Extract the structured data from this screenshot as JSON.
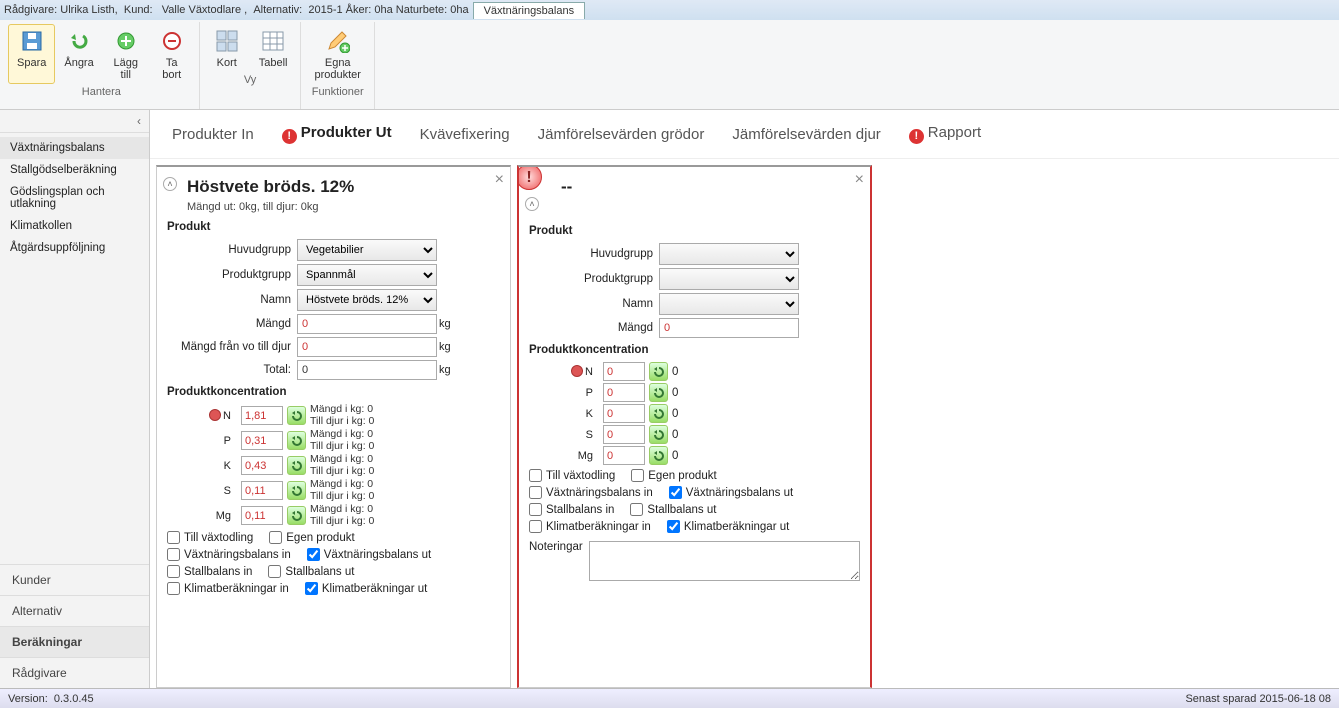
{
  "title": {
    "advisor_lbl": "Rådgivare:",
    "advisor_val": "Ulrika Listh,",
    "cust_lbl": "Kund:",
    "cust_val": "Valle Växtodlare ,",
    "alt_lbl": "Alternativ:",
    "alt_val": "2015-1 Åker: 0ha Naturbete: 0ha",
    "tab": "Växtnäringsbalans"
  },
  "ribbon": {
    "spara": "Spara",
    "angra": "Ångra",
    "lagg": "Lägg\ntill",
    "tabort": "Ta\nbort",
    "kort": "Kort",
    "tabell": "Tabell",
    "egna": "Egna\nprodukter",
    "g1": "Hantera",
    "g2": "Vy",
    "g3": "Funktioner"
  },
  "sidebar": {
    "items": [
      "Växtnäringsbalans",
      "Stallgödselberäkning",
      "Gödslingsplan och utlakning",
      "Klimatkollen",
      "Åtgärdsuppföljning"
    ],
    "bottom": [
      "Kunder",
      "Alternativ",
      "Beräkningar",
      "Rådgivare"
    ]
  },
  "tabs": [
    "Produkter In",
    "Produkter Ut",
    "Kvävefixering",
    "Jämförelsevärden grödor",
    "Jämförelsevärden djur",
    "Rapport"
  ],
  "panel1": {
    "title": "Höstvete bröds. 12%",
    "sub": "Mängd ut: 0kg, till djur: 0kg",
    "sect_prod": "Produkt",
    "huvud_lbl": "Huvudgrupp",
    "huvud_val": "Vegetabilier",
    "prodg_lbl": "Produktgrupp",
    "prodg_val": "Spannmål",
    "namn_lbl": "Namn",
    "namn_val": "Höstvete bröds. 12%",
    "mangd_lbl": "Mängd",
    "mangd_val": "0",
    "mvo_lbl": "Mängd från vo till djur",
    "mvo_val": "0",
    "total_lbl": "Total:",
    "total_val": "0",
    "kg": "kg",
    "sect_conc": "Produktkoncentration",
    "conc": [
      {
        "n": "N",
        "v": "1,81"
      },
      {
        "n": "P",
        "v": "0,31"
      },
      {
        "n": "K",
        "v": "0,43"
      },
      {
        "n": "S",
        "v": "0,11"
      },
      {
        "n": "Mg",
        "v": "0,11"
      }
    ],
    "info1": "Mängd i kg: 0",
    "info2": "Till djur i kg: 0",
    "chk": {
      "tillvaxt": "Till växtodling",
      "egen": "Egen produkt",
      "nbin": "Växtnäringsbalans in",
      "nbut": "Växtnäringsbalans ut",
      "stin": "Stallbalans in",
      "stut": "Stallbalans ut",
      "klin": "Klimatberäkningar in",
      "klut": "Klimatberäkningar ut"
    }
  },
  "panel2": {
    "title": "--",
    "sect_prod": "Produkt",
    "huvud_lbl": "Huvudgrupp",
    "prodg_lbl": "Produktgrupp",
    "namn_lbl": "Namn",
    "mangd_lbl": "Mängd",
    "mangd_val": "0",
    "sect_conc": "Produktkoncentration",
    "conc": [
      {
        "n": "N",
        "v": "0"
      },
      {
        "n": "P",
        "v": "0"
      },
      {
        "n": "K",
        "v": "0"
      },
      {
        "n": "S",
        "v": "0"
      },
      {
        "n": "Mg",
        "v": "0"
      }
    ],
    "zero": "0",
    "chk": {
      "tillvaxt": "Till växtodling",
      "egen": "Egen produkt",
      "nbin": "Växtnäringsbalans in",
      "nbut": "Växtnäringsbalans ut",
      "stin": "Stallbalans in",
      "stut": "Stallbalans ut",
      "klin": "Klimatberäkningar in",
      "klut": "Klimatberäkningar ut"
    },
    "noter_lbl": "Noteringar"
  },
  "status": {
    "ver_lbl": "Version:",
    "ver": "0.3.0.45",
    "saved_lbl": "Senast sparad",
    "saved": "2015-06-18 08"
  }
}
